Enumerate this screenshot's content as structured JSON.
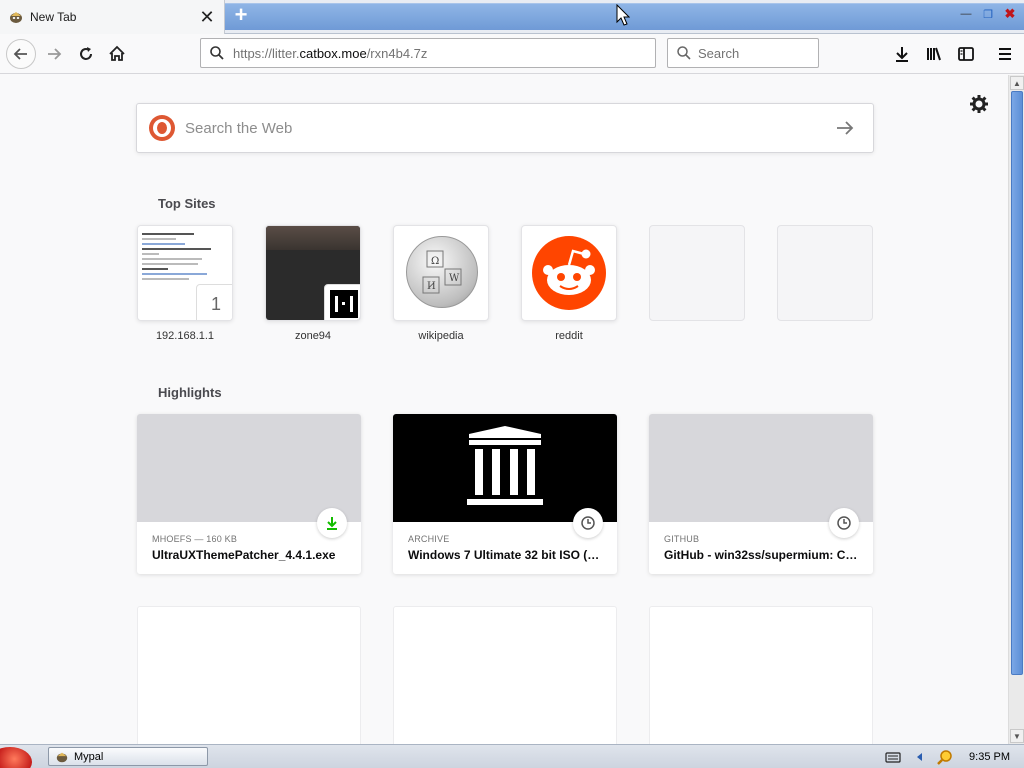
{
  "tab": {
    "title": "New Tab",
    "close_symbol": "✕",
    "favicon": "mypal-raccoon-icon"
  },
  "window": {
    "newtab_symbol": "+",
    "minimize_symbol": "—",
    "restore_symbol": "❐",
    "close_symbol": "✖"
  },
  "navbar": {
    "url_prefix": "https://litter.",
    "url_host": "catbox.moe",
    "url_path": "/rxn4b4.7z",
    "search_placeholder": "Search"
  },
  "newtab": {
    "search_placeholder": "Search the Web",
    "top_sites_title": "Top Sites",
    "highlights_title": "Highlights",
    "top_sites": [
      {
        "label": "192.168.1.1",
        "badge": "1"
      },
      {
        "label": "zone94"
      },
      {
        "label": "wikipedia"
      },
      {
        "label": "reddit"
      },
      {
        "label": ""
      },
      {
        "label": ""
      }
    ],
    "highlights": [
      {
        "context": "MHOEFS — 160 KB",
        "title": "UltraUXThemePatcher_4.4.1.exe",
        "badge": "download-icon"
      },
      {
        "context": "ARCHIVE",
        "title": "Windows 7 Ultimate 32 bit ISO (…",
        "badge": "clock-icon"
      },
      {
        "context": "GITHUB",
        "title": "GitHub - win32ss/supermium: C…",
        "badge": "clock-icon"
      }
    ]
  },
  "taskbar": {
    "app_label": "Mypal",
    "clock": "9:35 PM"
  },
  "colors": {
    "accent_blue": "#6f9ad6",
    "reddit_orange": "#ff4500",
    "ddg_orange": "#de5833",
    "download_green": "#12bc00"
  }
}
